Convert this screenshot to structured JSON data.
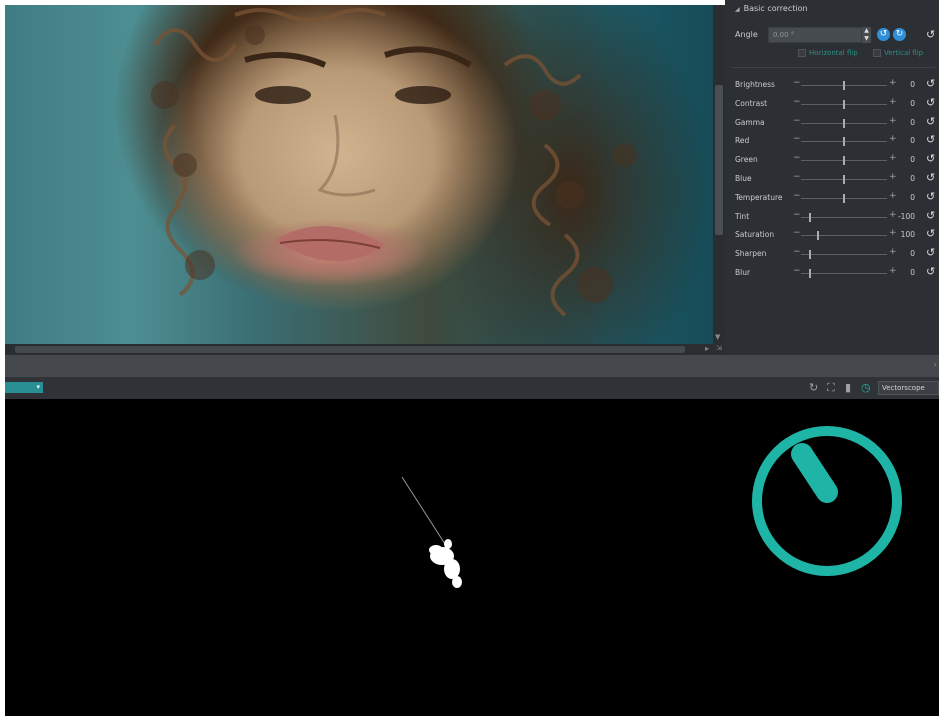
{
  "panel": {
    "section_title": "Basic correction",
    "angle": {
      "label": "Angle",
      "value": "0.00 °"
    },
    "flip_horizontal": "Horizontal flip",
    "flip_vertical": "Vertical flip",
    "adjustments": [
      {
        "label": "Brightness",
        "value": "0",
        "level": 0.5
      },
      {
        "label": "Contrast",
        "value": "0",
        "level": 0.5
      },
      {
        "label": "Gamma",
        "value": "0",
        "level": 0.5
      },
      {
        "label": "Red",
        "value": "0",
        "level": 0.5
      },
      {
        "label": "Green",
        "value": "0",
        "level": 0.5
      },
      {
        "label": "Blue",
        "value": "0",
        "level": 0.5
      },
      {
        "label": "Temperature",
        "value": "0",
        "level": 0.5
      },
      {
        "label": "Tint",
        "value": "-100",
        "level": 0.1
      },
      {
        "label": "Saturation",
        "value": "100",
        "level": 0.2
      },
      {
        "label": "Sharpen",
        "value": "0",
        "level": 0.1
      },
      {
        "label": "Blur",
        "value": "0",
        "level": 0.1
      }
    ]
  },
  "scope": {
    "mode": "Vectorscope",
    "accent_color": "#1fb5a6"
  },
  "colors": {
    "panel_bg": "#2c3034",
    "accent_blue": "#2f8fd8",
    "accent_teal": "#23b2a4"
  }
}
